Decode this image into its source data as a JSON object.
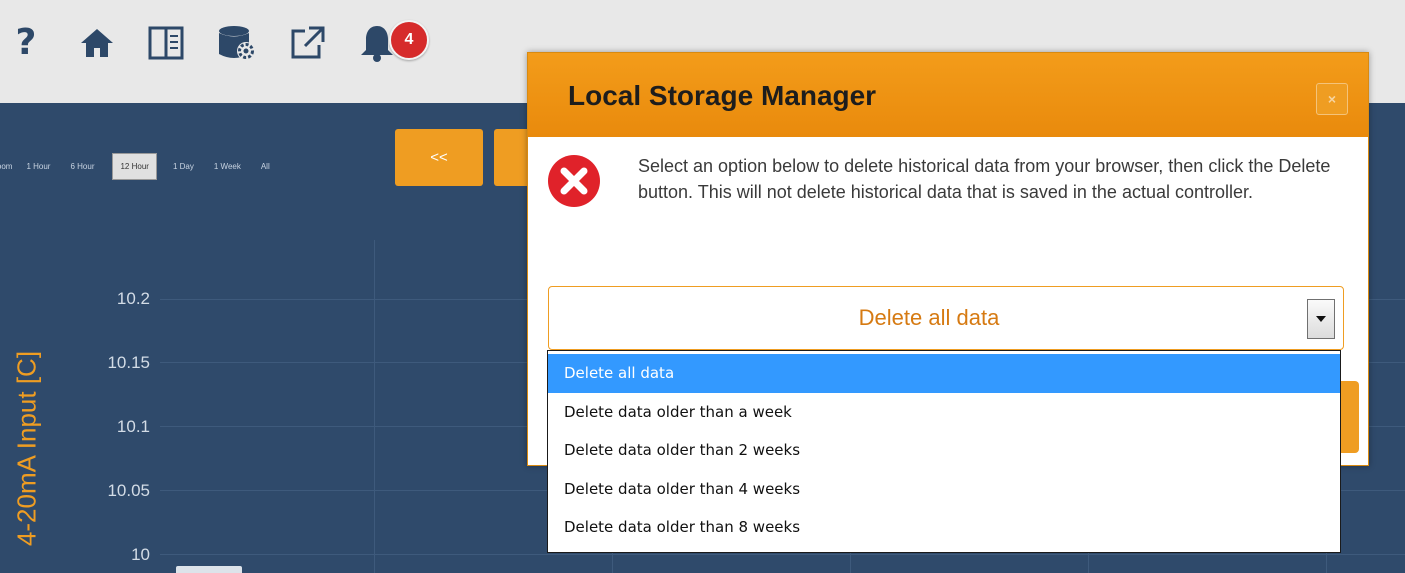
{
  "toolbar": {
    "icons": [
      "help-icon",
      "home-icon",
      "panel-icon",
      "database-settings-icon",
      "external-link-icon",
      "bell-icon"
    ],
    "notification_count": "4"
  },
  "chart": {
    "zoom_label": "Zoom",
    "zoom_options": [
      "1 Hour",
      "6 Hour",
      "12 Hour",
      "1 Day",
      "1 Week",
      "All"
    ],
    "active_zoom": "12 Hour",
    "nav_prev_label": "<<",
    "nav_next_label": ">",
    "y_axis_title": "4-20mA Input [C]",
    "accent_color": "#ef9d22",
    "background_color": "#2f4a6b"
  },
  "chart_data": {
    "type": "line",
    "ylabel": "4-20mA Input [C]",
    "y_ticks": [
      "10.2",
      "10.15",
      "10.1",
      "10.05",
      "10"
    ],
    "ylim": [
      10,
      10.2
    ],
    "grid": true
  },
  "modal": {
    "title": "Local Storage Manager",
    "close_label": "×",
    "message": "Select an option below to delete historical data from your browser, then click the Delete button. This will not delete historical data that is saved in the actual controller.",
    "icon": "error-icon",
    "select_value": "Delete all data",
    "select_options": [
      "Delete all data",
      "Delete data older than a week",
      "Delete data older than 2 weeks",
      "Delete data older than 4 weeks",
      "Delete data older than 8 weeks"
    ],
    "selected_index": 0
  }
}
